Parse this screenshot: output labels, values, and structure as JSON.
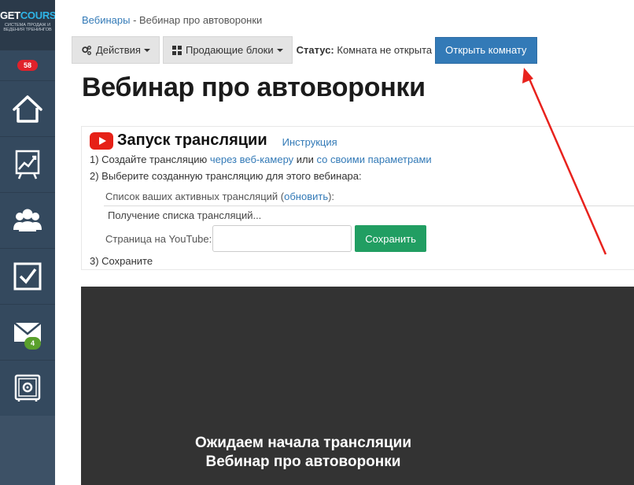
{
  "logo": {
    "title_part1": "GET",
    "title_part2": "COURSE",
    "subtitle": "СИСТЕМА ПРОДАЖ И ВЕДЕНИЯ ТРЕНИНГОВ"
  },
  "sidebar": {
    "notifications_count": "58",
    "items": [
      {
        "icon": "home-icon"
      },
      {
        "icon": "chart-board-icon"
      },
      {
        "icon": "users-icon"
      },
      {
        "icon": "checkbox-icon"
      },
      {
        "icon": "mail-icon",
        "badge": "4"
      },
      {
        "icon": "safe-icon"
      }
    ]
  },
  "breadcrumb": {
    "parent": "Вебинары",
    "separator": " - ",
    "current": "Вебинар про автоворонки"
  },
  "toolbar": {
    "actions_label": "Действия",
    "blocks_label": "Продающие блоки",
    "status_label": "Статус:",
    "status_value": "Комната не открыта",
    "open_room_label": "Открыть комнату"
  },
  "page": {
    "title": "Вебинар про автоворонки"
  },
  "stream": {
    "title": "Запуск трансляции",
    "instruction_link": "Инструкция",
    "step1_prefix": "1) Создайте трансляцию ",
    "step1_link1": "через веб-камеру",
    "step1_middle": " или ",
    "step1_link2": "со своими параметрами",
    "step2": "2) Выберите созданную трансляцию для этого вебинара:",
    "active_list_prefix": "Список ваших активных трансляций (",
    "refresh_link": "обновить",
    "active_list_suffix": "):",
    "loading_text": "Получение списка трансляций...",
    "youtube_page_label": "Страница на YouTube:",
    "youtube_input_value": "",
    "save_label": "Сохранить",
    "step3": "3) Сохраните"
  },
  "video": {
    "line1": "Ожидаем начала трансляции",
    "line2": "Вебинар про автоворонки"
  },
  "colors": {
    "sidebar_bg": "#34495e",
    "primary": "#337ab7",
    "save_green": "#219e62",
    "badge_red": "#e0222b",
    "badge_green": "#5aa02c",
    "annotation_arrow": "#e8221d",
    "video_bg": "#333333"
  }
}
